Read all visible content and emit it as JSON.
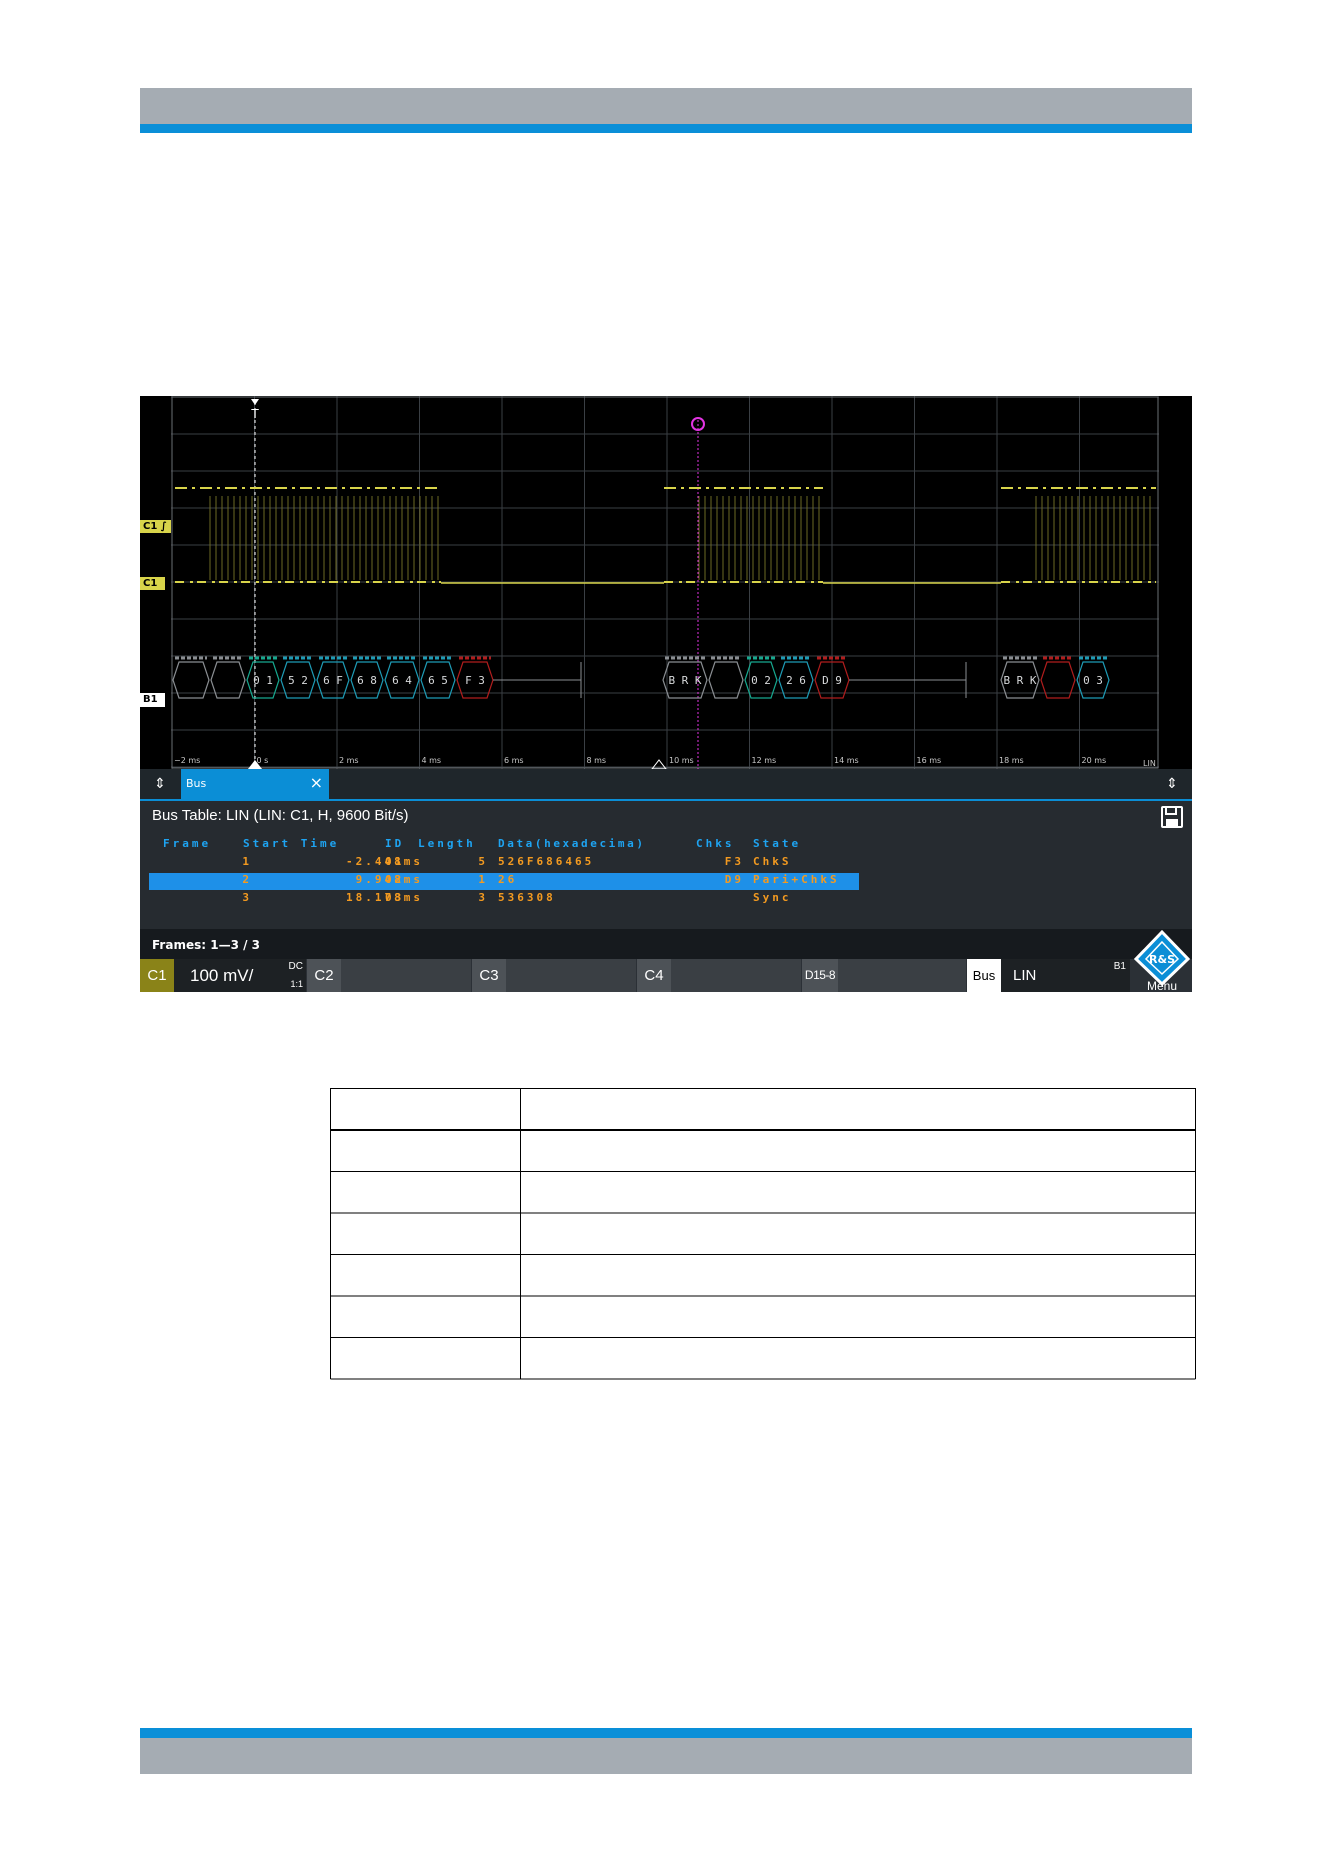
{
  "bus_table": {
    "title": "Bus Table: LIN (LIN: C1, H, 9600 Bit/s)",
    "columns": [
      "Frame",
      "Start Time",
      "ID",
      "Length",
      "Data(hexadecima)",
      "Chks",
      "State"
    ],
    "rows": [
      {
        "frame": "1",
        "start": "-2.448ms",
        "id": "01",
        "length": "5",
        "data": "526F686465",
        "chks": "F3",
        "state": "ChkS",
        "selected": false
      },
      {
        "frame": "2",
        "start": "9.948ms",
        "id": "02",
        "length": "1",
        "data": "26",
        "chks": "D9",
        "state": "Pari+ChkS",
        "selected": true
      },
      {
        "frame": "3",
        "start": "18.178ms",
        "id": "03",
        "length": "3",
        "data": "536308",
        "chks": "",
        "state": "Sync",
        "selected": false
      }
    ],
    "frames_label": "Frames:",
    "frames_value": "1—3 / 3"
  },
  "tab": {
    "label": "Bus",
    "close": "×"
  },
  "waveform": {
    "channel_labels": [
      "C1 ∫",
      "C1"
    ],
    "bus_label": "B1",
    "trigger_label": "T",
    "time_ticks": [
      "−2 ms",
      "0 s",
      "2 ms",
      "4 ms",
      "6 ms",
      "8 ms",
      "10 ms",
      "12 ms",
      "14 ms",
      "16 ms",
      "18 ms",
      "20 ms"
    ],
    "corner_label": "LIN",
    "decode": [
      {
        "label": "",
        "kind": "plain"
      },
      {
        "label": "",
        "kind": "plain"
      },
      {
        "label": "0 1",
        "kind": "id"
      },
      {
        "label": "5 2",
        "kind": "data"
      },
      {
        "label": "6 F",
        "kind": "data"
      },
      {
        "label": "6 8",
        "kind": "data"
      },
      {
        "label": "6 4",
        "kind": "data"
      },
      {
        "label": "6 5",
        "kind": "data"
      },
      {
        "label": "F 3",
        "kind": "err"
      },
      {
        "label": "B R K",
        "kind": "plain"
      },
      {
        "label": "",
        "kind": "plain"
      },
      {
        "label": "0 2",
        "kind": "id"
      },
      {
        "label": "2 6",
        "kind": "data"
      },
      {
        "label": "D 9",
        "kind": "err"
      },
      {
        "label": "B R K",
        "kind": "plain"
      },
      {
        "label": "",
        "kind": "err"
      },
      {
        "label": "0 3",
        "kind": "data"
      }
    ]
  },
  "channel_bar": {
    "c1": {
      "name": "C1",
      "scale": "100 mV/",
      "coupling": "DC",
      "ratio": "1:1"
    },
    "c2": "C2",
    "c3": "C3",
    "c4": "C4",
    "digital": "D15-8",
    "bus": {
      "name": "Bus",
      "protocol": "LIN",
      "id": "B1"
    },
    "menu": "Menu",
    "logo": "R&S"
  },
  "param_table": {
    "rows": 7
  },
  "colors": {
    "accent": "#0a8fd8",
    "trace": "#d8d44a",
    "decode_id": "#17a88f",
    "decode_data": "#1e9bb5",
    "decode_err": "#b01d1d",
    "table_value": "#f39a20",
    "trigger": "#e234e2"
  }
}
